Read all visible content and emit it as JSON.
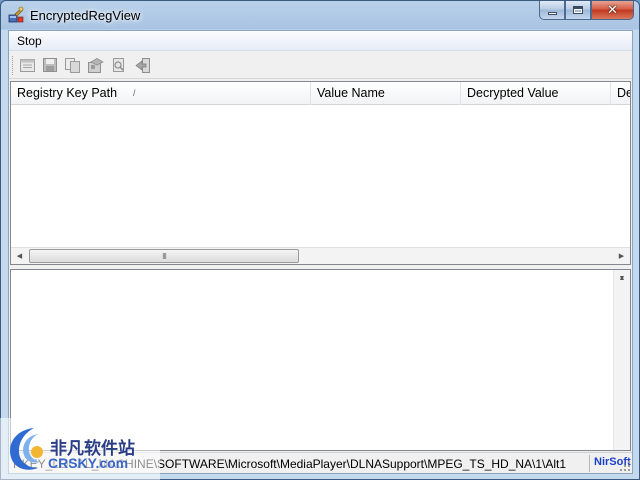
{
  "window": {
    "title": "EncryptedRegView"
  },
  "menu": {
    "items": [
      {
        "label": "Stop"
      }
    ]
  },
  "toolbar": {
    "buttons": [
      {
        "icon": "properties-icon"
      },
      {
        "icon": "save-icon"
      },
      {
        "icon": "copy-icon"
      },
      {
        "icon": "html-report-icon"
      },
      {
        "icon": "find-icon"
      },
      {
        "icon": "exit-icon"
      }
    ]
  },
  "listview": {
    "columns": [
      {
        "label": "Registry Key Path"
      },
      {
        "label": "Value Name"
      },
      {
        "label": "Decrypted Value"
      },
      {
        "label": "De"
      }
    ],
    "sort_indicator": "/",
    "scroll_thumb_label": "III"
  },
  "statusbar": {
    "path_text": "HKEY_LOCAL_MACHINE\\SOFTWARE\\Microsoft\\MediaPlayer\\DLNASupport\\MPEG_TS_HD_NA\\1\\Alt1",
    "nirsoft_link": "NirSoft"
  },
  "watermark": {
    "text_cn": "非凡软件站",
    "text_en": "CRSKY.com"
  },
  "colors": {
    "link_blue": "#1a3fc8",
    "title_gradient_top": "#b9d1ea",
    "close_red": "#c2381f"
  }
}
